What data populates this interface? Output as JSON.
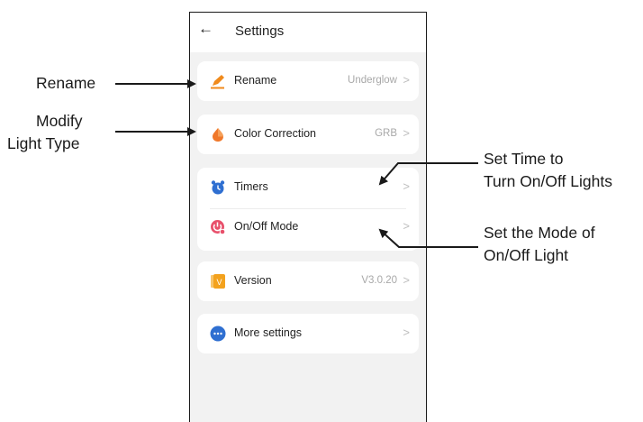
{
  "header": {
    "back_icon": "←",
    "title": "Settings"
  },
  "rows": {
    "rename": {
      "icon": "pencil-icon",
      "label": "Rename",
      "value": "Underglow"
    },
    "color_correction": {
      "icon": "paint-drop-icon",
      "label": "Color Correction",
      "value": "GRB"
    },
    "timers": {
      "icon": "alarm-clock-icon",
      "label": "Timers"
    },
    "onoff_mode": {
      "icon": "power-mode-icon",
      "label": "On/Off Mode"
    },
    "version": {
      "icon": "version-icon",
      "label": "Version",
      "value": "V3.0.20",
      "icon_letter": "V"
    },
    "more": {
      "icon": "more-dots-icon",
      "label": "More settings"
    }
  },
  "chevron": ">",
  "callouts": {
    "rename": "Rename",
    "modify_line1": "Modify",
    "modify_line2": "Light Type",
    "timer_line1": "Set Time to",
    "timer_line2": "Turn On/Off Lights",
    "mode_line1": "Set the Mode of",
    "mode_line2": "On/Off Light"
  },
  "colors": {
    "pencil": "#f08a1c",
    "drop": "#f0782a",
    "clock": "#2f6fd1",
    "power": "#e8506b",
    "version": "#f3a21e",
    "more": "#2f6fd1",
    "background": "#f2f2f2"
  }
}
